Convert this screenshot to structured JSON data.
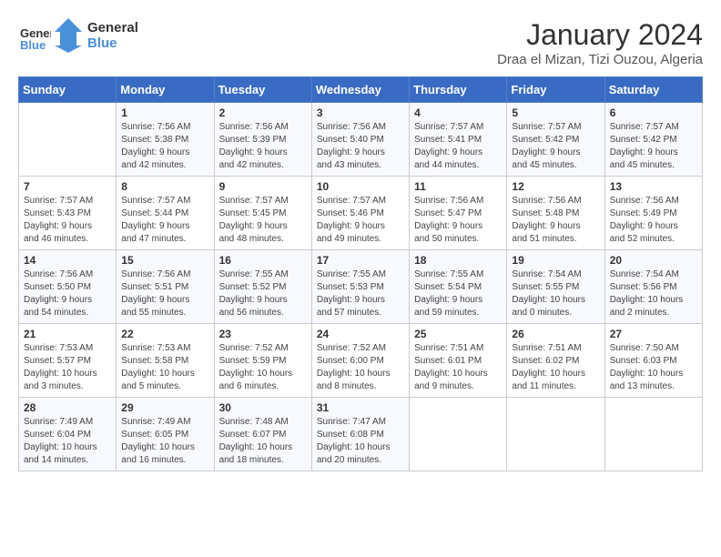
{
  "header": {
    "logo_line1": "General",
    "logo_line2": "Blue",
    "month_year": "January 2024",
    "location": "Draa el Mizan, Tizi Ouzou, Algeria"
  },
  "days_of_week": [
    "Sunday",
    "Monday",
    "Tuesday",
    "Wednesday",
    "Thursday",
    "Friday",
    "Saturday"
  ],
  "weeks": [
    [
      {
        "day": "",
        "info": ""
      },
      {
        "day": "1",
        "info": "Sunrise: 7:56 AM\nSunset: 5:38 PM\nDaylight: 9 hours\nand 42 minutes."
      },
      {
        "day": "2",
        "info": "Sunrise: 7:56 AM\nSunset: 5:39 PM\nDaylight: 9 hours\nand 42 minutes."
      },
      {
        "day": "3",
        "info": "Sunrise: 7:56 AM\nSunset: 5:40 PM\nDaylight: 9 hours\nand 43 minutes."
      },
      {
        "day": "4",
        "info": "Sunrise: 7:57 AM\nSunset: 5:41 PM\nDaylight: 9 hours\nand 44 minutes."
      },
      {
        "day": "5",
        "info": "Sunrise: 7:57 AM\nSunset: 5:42 PM\nDaylight: 9 hours\nand 45 minutes."
      },
      {
        "day": "6",
        "info": "Sunrise: 7:57 AM\nSunset: 5:42 PM\nDaylight: 9 hours\nand 45 minutes."
      }
    ],
    [
      {
        "day": "7",
        "info": "Sunrise: 7:57 AM\nSunset: 5:43 PM\nDaylight: 9 hours\nand 46 minutes."
      },
      {
        "day": "8",
        "info": "Sunrise: 7:57 AM\nSunset: 5:44 PM\nDaylight: 9 hours\nand 47 minutes."
      },
      {
        "day": "9",
        "info": "Sunrise: 7:57 AM\nSunset: 5:45 PM\nDaylight: 9 hours\nand 48 minutes."
      },
      {
        "day": "10",
        "info": "Sunrise: 7:57 AM\nSunset: 5:46 PM\nDaylight: 9 hours\nand 49 minutes."
      },
      {
        "day": "11",
        "info": "Sunrise: 7:56 AM\nSunset: 5:47 PM\nDaylight: 9 hours\nand 50 minutes."
      },
      {
        "day": "12",
        "info": "Sunrise: 7:56 AM\nSunset: 5:48 PM\nDaylight: 9 hours\nand 51 minutes."
      },
      {
        "day": "13",
        "info": "Sunrise: 7:56 AM\nSunset: 5:49 PM\nDaylight: 9 hours\nand 52 minutes."
      }
    ],
    [
      {
        "day": "14",
        "info": "Sunrise: 7:56 AM\nSunset: 5:50 PM\nDaylight: 9 hours\nand 54 minutes."
      },
      {
        "day": "15",
        "info": "Sunrise: 7:56 AM\nSunset: 5:51 PM\nDaylight: 9 hours\nand 55 minutes."
      },
      {
        "day": "16",
        "info": "Sunrise: 7:55 AM\nSunset: 5:52 PM\nDaylight: 9 hours\nand 56 minutes."
      },
      {
        "day": "17",
        "info": "Sunrise: 7:55 AM\nSunset: 5:53 PM\nDaylight: 9 hours\nand 57 minutes."
      },
      {
        "day": "18",
        "info": "Sunrise: 7:55 AM\nSunset: 5:54 PM\nDaylight: 9 hours\nand 59 minutes."
      },
      {
        "day": "19",
        "info": "Sunrise: 7:54 AM\nSunset: 5:55 PM\nDaylight: 10 hours\nand 0 minutes."
      },
      {
        "day": "20",
        "info": "Sunrise: 7:54 AM\nSunset: 5:56 PM\nDaylight: 10 hours\nand 2 minutes."
      }
    ],
    [
      {
        "day": "21",
        "info": "Sunrise: 7:53 AM\nSunset: 5:57 PM\nDaylight: 10 hours\nand 3 minutes."
      },
      {
        "day": "22",
        "info": "Sunrise: 7:53 AM\nSunset: 5:58 PM\nDaylight: 10 hours\nand 5 minutes."
      },
      {
        "day": "23",
        "info": "Sunrise: 7:52 AM\nSunset: 5:59 PM\nDaylight: 10 hours\nand 6 minutes."
      },
      {
        "day": "24",
        "info": "Sunrise: 7:52 AM\nSunset: 6:00 PM\nDaylight: 10 hours\nand 8 minutes."
      },
      {
        "day": "25",
        "info": "Sunrise: 7:51 AM\nSunset: 6:01 PM\nDaylight: 10 hours\nand 9 minutes."
      },
      {
        "day": "26",
        "info": "Sunrise: 7:51 AM\nSunset: 6:02 PM\nDaylight: 10 hours\nand 11 minutes."
      },
      {
        "day": "27",
        "info": "Sunrise: 7:50 AM\nSunset: 6:03 PM\nDaylight: 10 hours\nand 13 minutes."
      }
    ],
    [
      {
        "day": "28",
        "info": "Sunrise: 7:49 AM\nSunset: 6:04 PM\nDaylight: 10 hours\nand 14 minutes."
      },
      {
        "day": "29",
        "info": "Sunrise: 7:49 AM\nSunset: 6:05 PM\nDaylight: 10 hours\nand 16 minutes."
      },
      {
        "day": "30",
        "info": "Sunrise: 7:48 AM\nSunset: 6:07 PM\nDaylight: 10 hours\nand 18 minutes."
      },
      {
        "day": "31",
        "info": "Sunrise: 7:47 AM\nSunset: 6:08 PM\nDaylight: 10 hours\nand 20 minutes."
      },
      {
        "day": "",
        "info": ""
      },
      {
        "day": "",
        "info": ""
      },
      {
        "day": "",
        "info": ""
      }
    ]
  ]
}
